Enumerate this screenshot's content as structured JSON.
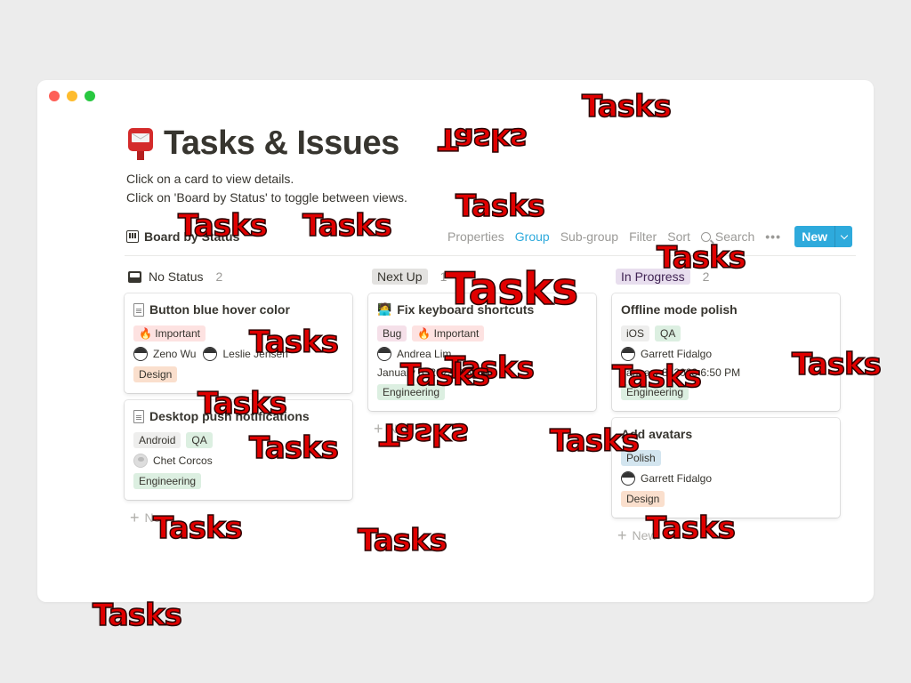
{
  "window": {
    "controls": [
      "close",
      "minimize",
      "zoom"
    ]
  },
  "page": {
    "icon": "postbox-icon",
    "title": "Tasks & Issues",
    "description": [
      "Click on a card to view details.",
      "Click on 'Board by Status' to toggle between views."
    ]
  },
  "toolbar": {
    "view_label": "Board by Status",
    "properties": "Properties",
    "group": "Group",
    "subgroup": "Sub-group",
    "filter": "Filter",
    "sort": "Sort",
    "search": "Search",
    "more": "•••",
    "new_label": "New"
  },
  "colors": {
    "accent": "#2eaadc",
    "tag_important": "#fde2e1",
    "tag_design": "#fadfcd",
    "tag_gray": "#eeeeed",
    "tag_green": "#dcefe1",
    "tag_bug": "#f5e0e9",
    "tag_polish": "#d3e5ef",
    "status_next_up": "#e3e2e0",
    "status_in_progress": "#e8deee"
  },
  "columns": [
    {
      "name": "No Status",
      "count": "2",
      "cards": [
        {
          "icon": "doc",
          "title": "Button blue hover color",
          "tags": [
            {
              "label": "🔥 Important",
              "color": "#fde2e1"
            }
          ],
          "people": [
            "Zeno Wu",
            "Leslie Jensen"
          ],
          "date": "",
          "team": {
            "label": "Design",
            "color": "#fadfcd"
          }
        },
        {
          "icon": "doc",
          "title": "Desktop push notifications",
          "tags": [
            {
              "label": "Android",
              "color": "#eeeeed"
            },
            {
              "label": "QA",
              "color": "#dcefe1"
            }
          ],
          "people": [
            "Chet Corcos"
          ],
          "date": "",
          "team": {
            "label": "Engineering",
            "color": "#dcefe1"
          }
        }
      ],
      "add_label": "New"
    },
    {
      "name": "Next Up",
      "count": "1",
      "cards": [
        {
          "icon": "emoji",
          "emoji": "🧑‍💻",
          "title": "Fix keyboard shortcuts",
          "tags": [
            {
              "label": "Bug",
              "color": "#f5e0e9"
            },
            {
              "label": "🔥 Important",
              "color": "#fde2e1"
            }
          ],
          "people": [
            "Andrea Lim"
          ],
          "date": "January 8, 2023 6:50 PM",
          "team": {
            "label": "Engineering",
            "color": "#dcefe1"
          }
        }
      ],
      "add_label": "New"
    },
    {
      "name": "In Progress",
      "count": "2",
      "cards": [
        {
          "icon": "none",
          "title": "Offline mode polish",
          "tags": [
            {
              "label": "iOS",
              "color": "#eeeeed"
            },
            {
              "label": "QA",
              "color": "#dcefe1"
            }
          ],
          "people": [
            "Garrett Fidalgo"
          ],
          "date": "January 8, 2023 6:50 PM",
          "team": {
            "label": "Engineering",
            "color": "#dcefe1"
          }
        },
        {
          "icon": "none",
          "title": "Add avatars",
          "tags": [
            {
              "label": "Polish",
              "color": "#d3e5ef"
            }
          ],
          "people": [
            "Garrett Fidalgo"
          ],
          "date": "",
          "team": {
            "label": "Design",
            "color": "#fadfcd"
          }
        }
      ],
      "add_label": "New"
    }
  ],
  "overlays": [
    {
      "text": "Tasks",
      "flipped": false
    },
    {
      "text": "Tasks",
      "flipped": true
    },
    {
      "text": "Tasks",
      "flipped": false
    },
    {
      "text": "Tasks",
      "flipped": false
    },
    {
      "text": "Tasks",
      "flipped": false
    },
    {
      "text": "Tasks",
      "flipped": false
    },
    {
      "text": "Tasks",
      "flipped": false
    },
    {
      "text": "Tasks",
      "flipped": false
    },
    {
      "text": "Tasks",
      "flipped": false
    },
    {
      "text": "Tasks",
      "flipped": false
    },
    {
      "text": "Tasks",
      "flipped": false
    },
    {
      "text": "Tasks",
      "flipped": false
    },
    {
      "text": "Tasks",
      "flipped": false
    },
    {
      "text": "Tasks",
      "flipped": false
    },
    {
      "text": "Tasks",
      "flipped": true
    },
    {
      "text": "Tasks",
      "flipped": false
    },
    {
      "text": "Tasks",
      "flipped": false
    },
    {
      "text": "Tasks",
      "flipped": false
    },
    {
      "text": "Tasks",
      "flipped": false
    },
    {
      "text": "Tasks",
      "flipped": false
    }
  ]
}
